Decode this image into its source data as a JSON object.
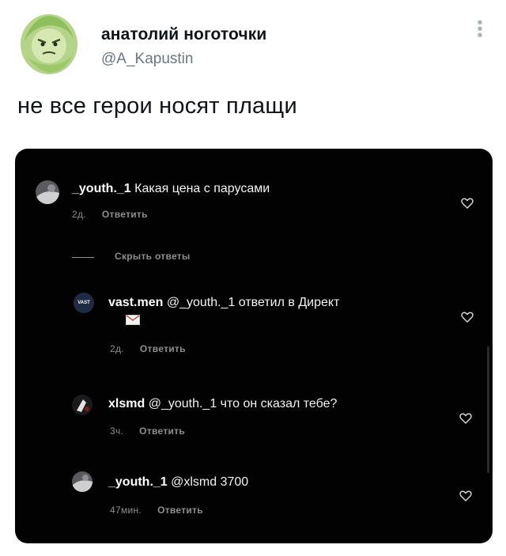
{
  "tweet": {
    "display_name": "анатолий ноготочки",
    "handle": "@A_Kapustin",
    "text": "не все герои носят плащи"
  },
  "comments": [
    {
      "user": "_youth._1",
      "text": " Какая цена с парусами",
      "time": "2д.",
      "reply_label": "Ответить"
    },
    {
      "user": "vast.men",
      "text": " @_youth._1 ответил в Директ",
      "time": "2д.",
      "reply_label": "Ответить",
      "avatar_text": "VAST"
    },
    {
      "user": "xlsmd",
      "text": " @_youth._1 что он сказал тебе?",
      "time": "3ч.",
      "reply_label": "Ответить"
    },
    {
      "user": "_youth._1",
      "text": " @xlsmd 3700",
      "time": "47мин.",
      "reply_label": "Ответить"
    }
  ],
  "hide_replies_label": "Скрыть ответы",
  "icons": {
    "more": "more-vertical-icon",
    "like": "heart-outline-icon",
    "envelope": "envelope-emoji-icon"
  },
  "colors": {
    "background": "#ffffff",
    "media_background": "#020203",
    "muted_text": "#8e8e8e",
    "handle": "#6b7782"
  }
}
